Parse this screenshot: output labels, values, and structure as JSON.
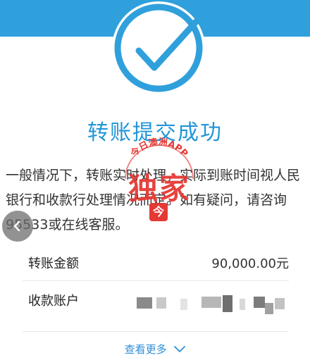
{
  "result": {
    "title": "转账提交成功",
    "description": "一般情况下，转账实时处理，实际到账时间视人民银行和收款行处理情况而定。如有疑问，请咨询95533或在线客服。"
  },
  "watermark": {
    "ring_text": "今日澳洲APP",
    "main_text": "独家",
    "badge": "今"
  },
  "details": {
    "amount_label": "转账金额",
    "amount_value": "90,000.00元",
    "account_label": "收款账户"
  },
  "more_link": "查看更多",
  "colors": {
    "brand_blue": "#2fa0dc",
    "title_blue": "#2196d6",
    "watermark_red": "#e53935"
  },
  "icons": [
    "success-check-icon",
    "back-arrow-icon",
    "chevron-down-icon"
  ]
}
